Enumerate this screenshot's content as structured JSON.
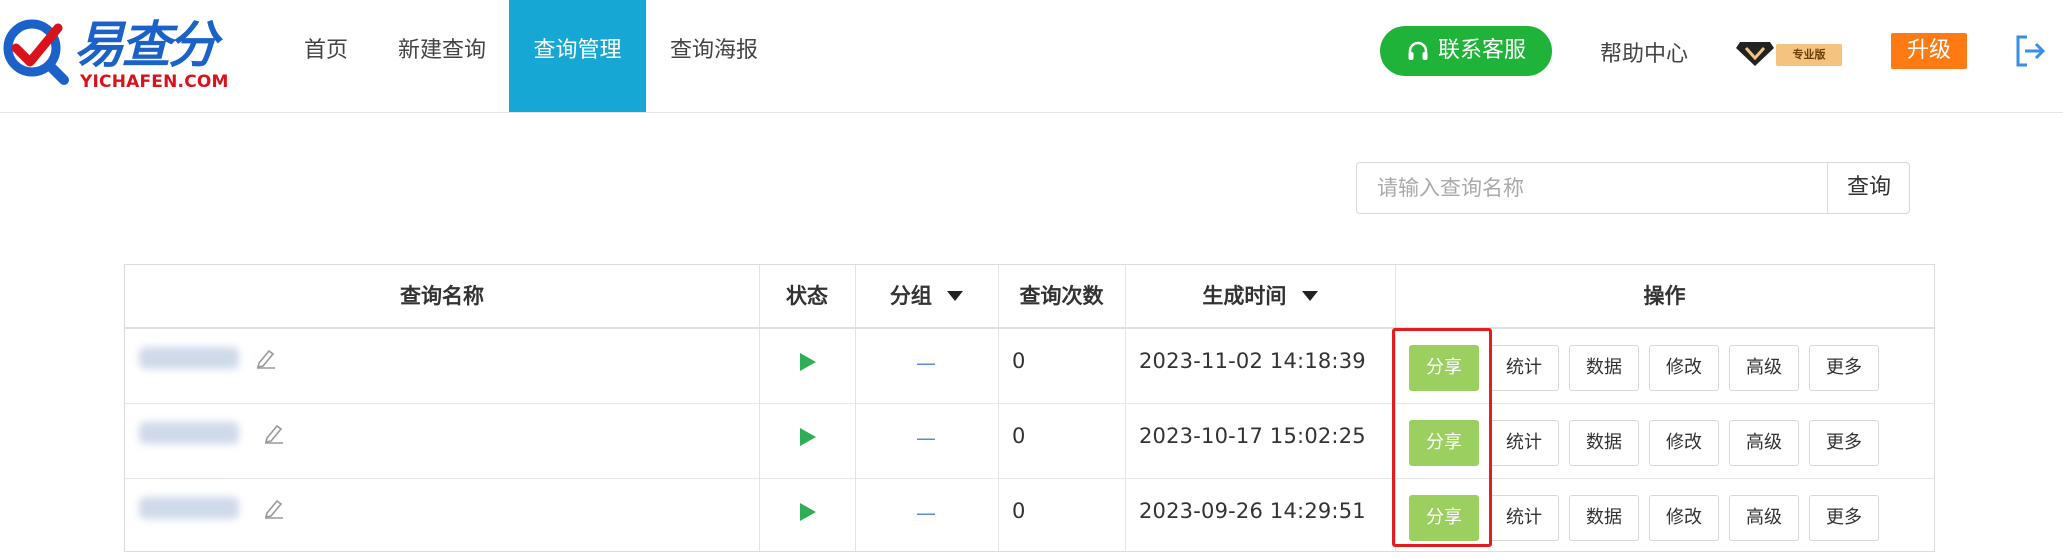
{
  "logo": {
    "cn": "易查分",
    "en": "YICHAFEN.COM"
  },
  "nav": [
    {
      "label": "首页",
      "active": false
    },
    {
      "label": "新建查询",
      "active": false
    },
    {
      "label": "查询管理",
      "active": true
    },
    {
      "label": "查询海报",
      "active": false
    }
  ],
  "header": {
    "service_label": "联系客服",
    "help_label": "帮助中心",
    "vip_tag": "专业版",
    "upgrade_label": "升级"
  },
  "search": {
    "placeholder": "请输入查询名称",
    "button_label": "查询"
  },
  "table": {
    "columns": [
      "查询名称",
      "状态",
      "分组",
      "查询次数",
      "生成时间",
      "操作"
    ],
    "rows": [
      {
        "name": "",
        "status": "running",
        "group": "—",
        "count": "0",
        "time": "2023-11-02 14:18:39"
      },
      {
        "name": "",
        "status": "running",
        "group": "—",
        "count": "0",
        "time": "2023-10-17 15:02:25"
      },
      {
        "name": "",
        "status": "running",
        "group": "—",
        "count": "0",
        "time": "2023-09-26 14:29:51"
      }
    ],
    "actions": [
      "分享",
      "统计",
      "数据",
      "修改",
      "高级",
      "更多"
    ]
  },
  "colors": {
    "accent": "#17a7d5",
    "service_green": "#1fb33a",
    "upgrade_orange": "#ff7a12",
    "share_green": "#9bcf60",
    "highlight_red": "#e21d1d"
  },
  "icons": {
    "service": "headset-icon",
    "vip": "diamond-icon",
    "logout": "logout-icon",
    "edit": "pencil-icon",
    "status": "play-icon",
    "sort": "caret-down-icon"
  }
}
